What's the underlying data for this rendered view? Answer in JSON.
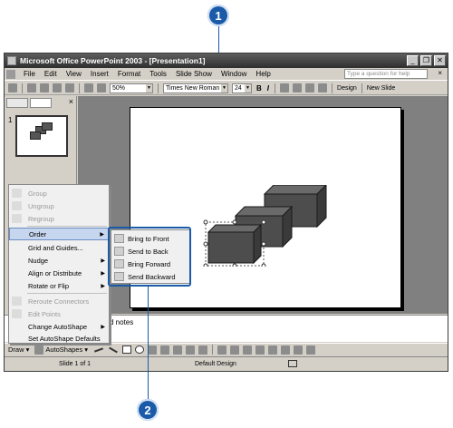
{
  "callouts": {
    "top": "1",
    "bottom": "2"
  },
  "window": {
    "title": "Microsoft Office PowerPoint 2003 - [Presentation1]",
    "controls": [
      "_",
      "❐",
      "✕"
    ]
  },
  "menubar": {
    "items": [
      "File",
      "Edit",
      "View",
      "Insert",
      "Format",
      "Tools",
      "Slide Show",
      "Window",
      "Help"
    ],
    "help_placeholder": "Type a question for help",
    "close": "×"
  },
  "toolbar": {
    "zoom": "50%",
    "font": "Times New Roman",
    "size": "24",
    "bold": "B",
    "italic": "I",
    "design": "Design",
    "new_slide": "New Slide"
  },
  "slide_pane": {
    "number": "1",
    "close": "×"
  },
  "notes": {
    "label": "d notes"
  },
  "drawbar": {
    "draw": "Draw ▾",
    "autoshapes": "AutoShapes ▾"
  },
  "status": {
    "slide": "Slide 1 of 1",
    "design": "Default Design"
  },
  "context_menu": {
    "items": [
      {
        "label": "Group",
        "disabled": true
      },
      {
        "label": "Ungroup",
        "disabled": true
      },
      {
        "label": "Regroup",
        "disabled": true
      },
      {
        "label": "Order",
        "disabled": false
      },
      {
        "label": "Grid and Guides...",
        "disabled": false
      },
      {
        "label": "Nudge",
        "disabled": false
      },
      {
        "label": "Align or Distribute",
        "disabled": false
      },
      {
        "label": "Rotate or Flip",
        "disabled": false
      },
      {
        "label": "Reroute Connectors",
        "disabled": true
      },
      {
        "label": "Edit Points",
        "disabled": true
      },
      {
        "label": "Change AutoShape",
        "disabled": false
      },
      {
        "label": "Set AutoShape Defaults",
        "disabled": false
      }
    ]
  },
  "order_submenu": {
    "items": [
      "Bring to Front",
      "Send to Back",
      "Bring Forward",
      "Send Backward"
    ]
  }
}
